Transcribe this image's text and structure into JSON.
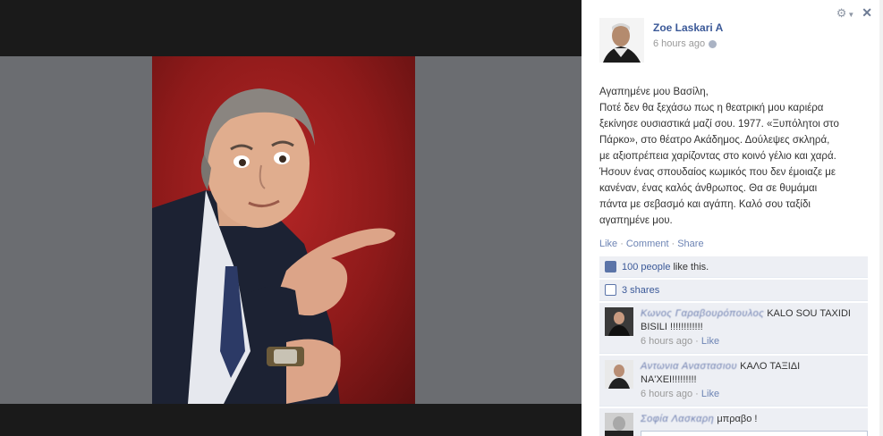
{
  "post": {
    "author": "Zoe Laskari A",
    "time": "6 hours ago",
    "lines": [
      "Αγαπημένε μου Βασίλη,",
      "Ποτέ δεν θα ξεχάσω πως η θεατρική μου καριέρα",
      "ξεκίνησε ουσιαστικά μαζί σου. 1977. «Ξυπόλητοι στο",
      "Πάρκο», στο θέατρο Ακάδημος. Δούλεψες σκληρά,",
      "με αξιοπρέπεια χαρίζοντας στο κοινό γέλιο και χαρά.",
      "Ήσουν ένας σπουδαίος κωμικός που δεν έμοιαζε με",
      "κανέναν, ένας καλός άνθρωπος. Θα σε θυμάμαι",
      "πάντα με σεβασμό και αγάπη. Καλό σου ταξίδι",
      "αγαπημένε μου."
    ]
  },
  "actions": {
    "like": "Like",
    "comment": "Comment",
    "share": "Share"
  },
  "likes": {
    "count": "100 people",
    "suffix": "like this."
  },
  "shares": {
    "label": "3 shares"
  },
  "comments": [
    {
      "name": "Κωνος Γαραβουρόπουλος",
      "text_first": "KALO SOU TAXIDI",
      "text_rest": "BISILI !!!!!!!!!!!!",
      "time": "6 hours ago",
      "like": "Like"
    },
    {
      "name": "Αντωνια Αναστασιου",
      "text_first": "ΚΑΛΟ ΤΑΞΙΔΙ",
      "text_rest": "ΝΑ'ΧΕΙ!!!!!!!!!",
      "time": "6 hours ago",
      "like": "Like"
    },
    {
      "name": "Σοφία Λασκαρη",
      "text_first": "μπραβο !"
    }
  ],
  "controls": {
    "gear": "gear-icon",
    "close": "close-icon"
  },
  "colors": {
    "link": "#3b5998",
    "ufi_bg": "#edeff4",
    "photo_bg": "#a11f1f"
  }
}
